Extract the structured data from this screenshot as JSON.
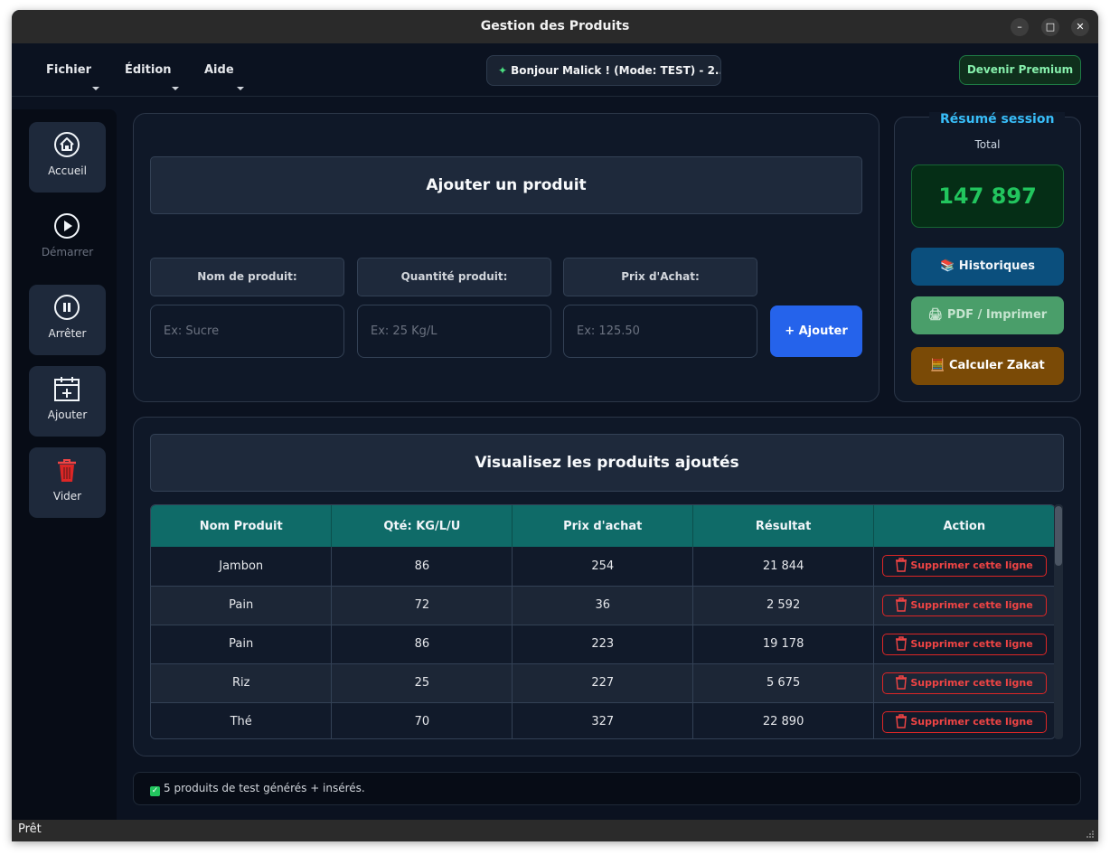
{
  "window": {
    "title": "Gestion des Produits",
    "controls": {
      "minimize": "–",
      "maximize": "□",
      "close": "✕"
    }
  },
  "menubar": {
    "items": [
      "Fichier",
      "Édition",
      "Aide"
    ],
    "greeting": "Bonjour Malick ! (Mode: TEST) - 2..",
    "premium_label": "Devenir Premium"
  },
  "sidebar": {
    "items": [
      {
        "label": "Accueil",
        "icon": "home-icon"
      },
      {
        "label": "Démarrer",
        "icon": "play-icon"
      },
      {
        "label": "Arrêter",
        "icon": "pause-icon"
      },
      {
        "label": "Ajouter",
        "icon": "calendar-add-icon"
      },
      {
        "label": "Vider",
        "icon": "trash-icon"
      }
    ]
  },
  "add_form": {
    "title": "Ajouter un produit",
    "fields": [
      {
        "label": "Nom de produit:",
        "placeholder": "Ex: Sucre"
      },
      {
        "label": "Quantité produit:",
        "placeholder": "Ex: 25 Kg/L"
      },
      {
        "label": "Prix d'Achat:",
        "placeholder": "Ex: 125.50"
      }
    ],
    "submit_label": "+ Ajouter"
  },
  "summary": {
    "title": "Résumé session",
    "total_label": "Total",
    "total_value": "147 897",
    "buttons": [
      {
        "label": "Historiques",
        "icon": "books-icon",
        "color": "#0b4f7d"
      },
      {
        "label": "PDF / Imprimer",
        "icon": "printer-icon",
        "color": "#4a9e6a"
      },
      {
        "label": "Calculer Zakat",
        "icon": "abacus-icon",
        "color": "#7a4a06"
      }
    ]
  },
  "products_table": {
    "title": "Visualisez les produits ajoutés",
    "columns": [
      "Nom Produit",
      "Qté: KG/L/U",
      "Prix d'achat",
      "Résultat",
      "Action"
    ],
    "delete_label": "Supprimer cette ligne",
    "rows": [
      {
        "name": "Jambon",
        "qty": "86",
        "price": "254",
        "result": "21 844"
      },
      {
        "name": "Pain",
        "qty": "72",
        "price": "36",
        "result": "2 592"
      },
      {
        "name": "Pain",
        "qty": "86",
        "price": "223",
        "result": "19 178"
      },
      {
        "name": "Riz",
        "qty": "25",
        "price": "227",
        "result": "5 675"
      },
      {
        "name": "Thé",
        "qty": "70",
        "price": "327",
        "result": "22 890"
      }
    ]
  },
  "status": {
    "message": "5 produits de test générés + insérés.",
    "bar": "Prêt"
  }
}
